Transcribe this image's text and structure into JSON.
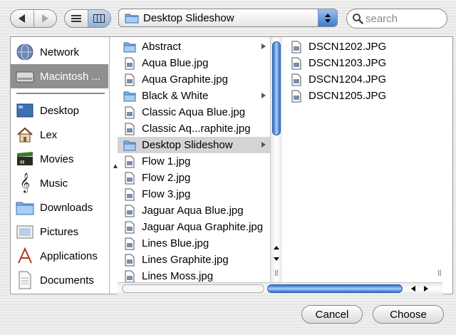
{
  "toolbar": {
    "back_icon": "back-arrow-icon",
    "forward_icon": "forward-arrow-icon",
    "view_list_icon": "list-view-icon",
    "view_column_icon": "column-view-icon",
    "location": "Desktop Slideshow",
    "search_placeholder": "search"
  },
  "sidebar": {
    "items": [
      {
        "label": "Network",
        "icon": "network-globe-icon"
      },
      {
        "label": "Macintosh ...",
        "icon": "hard-drive-icon",
        "selected": true
      },
      {
        "label": "Desktop",
        "icon": "desktop-icon"
      },
      {
        "label": "Lex",
        "icon": "home-icon"
      },
      {
        "label": "Movies",
        "icon": "clapperboard-icon"
      },
      {
        "label": "Music",
        "icon": "music-note-icon"
      },
      {
        "label": "Downloads",
        "icon": "downloads-folder-icon"
      },
      {
        "label": "Pictures",
        "icon": "pictures-icon"
      },
      {
        "label": "Applications",
        "icon": "applications-icon"
      },
      {
        "label": "Documents",
        "icon": "documents-icon"
      }
    ]
  },
  "column1": {
    "items": [
      {
        "label": "Abstract",
        "type": "folder",
        "has_children": true
      },
      {
        "label": "Aqua Blue.jpg",
        "type": "file"
      },
      {
        "label": "Aqua Graphite.jpg",
        "type": "file"
      },
      {
        "label": "Black & White",
        "type": "folder",
        "has_children": true
      },
      {
        "label": "Classic Aqua Blue.jpg",
        "type": "file"
      },
      {
        "label": "Classic Aq...raphite.jpg",
        "type": "file"
      },
      {
        "label": "Desktop Slideshow",
        "type": "folder",
        "has_children": true,
        "selected": true
      },
      {
        "label": "Flow 1.jpg",
        "type": "file"
      },
      {
        "label": "Flow 2.jpg",
        "type": "file"
      },
      {
        "label": "Flow 3.jpg",
        "type": "file"
      },
      {
        "label": "Jaguar Aqua Blue.jpg",
        "type": "file"
      },
      {
        "label": "Jaguar Aqua Graphite.jpg",
        "type": "file"
      },
      {
        "label": "Lines Blue.jpg",
        "type": "file"
      },
      {
        "label": "Lines Graphite.jpg",
        "type": "file"
      },
      {
        "label": "Lines Moss.jpg",
        "type": "file"
      }
    ]
  },
  "column2": {
    "items": [
      {
        "label": "DSCN1202.JPG",
        "type": "file"
      },
      {
        "label": "DSCN1203.JPG",
        "type": "file"
      },
      {
        "label": "DSCN1204.JPG",
        "type": "file"
      },
      {
        "label": "DSCN1205.JPG",
        "type": "file"
      }
    ]
  },
  "actions": {
    "cancel_label": "Cancel",
    "choose_label": "Choose"
  },
  "colors": {
    "accent": "#3f7ad1",
    "selection_gray": "#8f8f8f"
  }
}
